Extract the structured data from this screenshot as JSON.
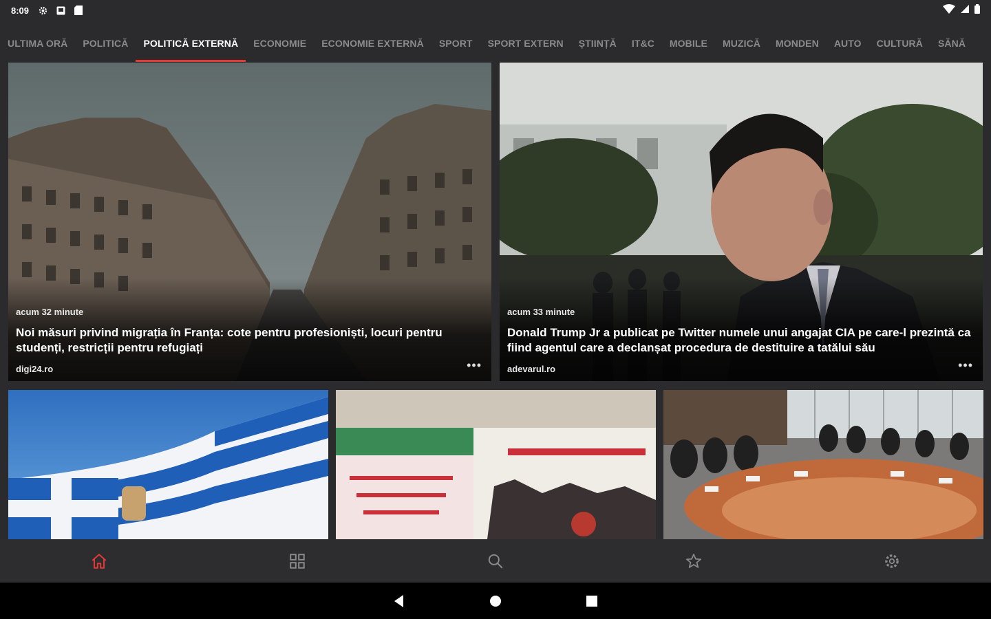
{
  "status_bar": {
    "time": "8:09",
    "icons": [
      "settings-gear-icon",
      "notification-box-icon",
      "sd-card-icon"
    ],
    "right_icons": [
      "wifi-icon",
      "signal-icon",
      "battery-icon"
    ]
  },
  "tabs": [
    {
      "label": "ULTIMA ORĂ",
      "active": false
    },
    {
      "label": "POLITICĂ",
      "active": false
    },
    {
      "label": "POLITICĂ EXTERNĂ",
      "active": true
    },
    {
      "label": "ECONOMIE",
      "active": false
    },
    {
      "label": "ECONOMIE EXTERNĂ",
      "active": false
    },
    {
      "label": "SPORT",
      "active": false
    },
    {
      "label": "SPORT EXTERN",
      "active": false
    },
    {
      "label": "ȘTIINȚĂ",
      "active": false
    },
    {
      "label": "IT&C",
      "active": false
    },
    {
      "label": "MOBILE",
      "active": false
    },
    {
      "label": "MUZICĂ",
      "active": false
    },
    {
      "label": "MONDEN",
      "active": false
    },
    {
      "label": "AUTO",
      "active": false
    },
    {
      "label": "CULTURĂ",
      "active": false
    },
    {
      "label": "SĂNĂ",
      "active": false
    }
  ],
  "articles": [
    {
      "time": "acum 32 minute",
      "title": "Noi măsuri privind migrația în Franța: cote pentru profesioniști, locuri pentru studenți, restricții pentru refugiați",
      "source": "digi24.ro",
      "more": "•••"
    },
    {
      "time": "acum 33 minute",
      "title": "Donald Trump Jr a publicat pe Twitter numele unui angajat CIA pe care-l prezintă ca fiind agentul care a declanșat procedura de destituire a tatălui său",
      "source": "adevarul.ro",
      "more": "•••"
    }
  ],
  "bottom_nav": [
    {
      "icon": "home-icon",
      "active": true
    },
    {
      "icon": "grid-icon",
      "active": false
    },
    {
      "icon": "search-icon",
      "active": false
    },
    {
      "icon": "star-icon",
      "active": false
    },
    {
      "icon": "settings-icon",
      "active": false
    }
  ],
  "colors": {
    "accent": "#e53935",
    "background": "#2b2b2d",
    "tab_inactive": "#8b8b8e",
    "nav_icon": "#8b8b8e"
  }
}
